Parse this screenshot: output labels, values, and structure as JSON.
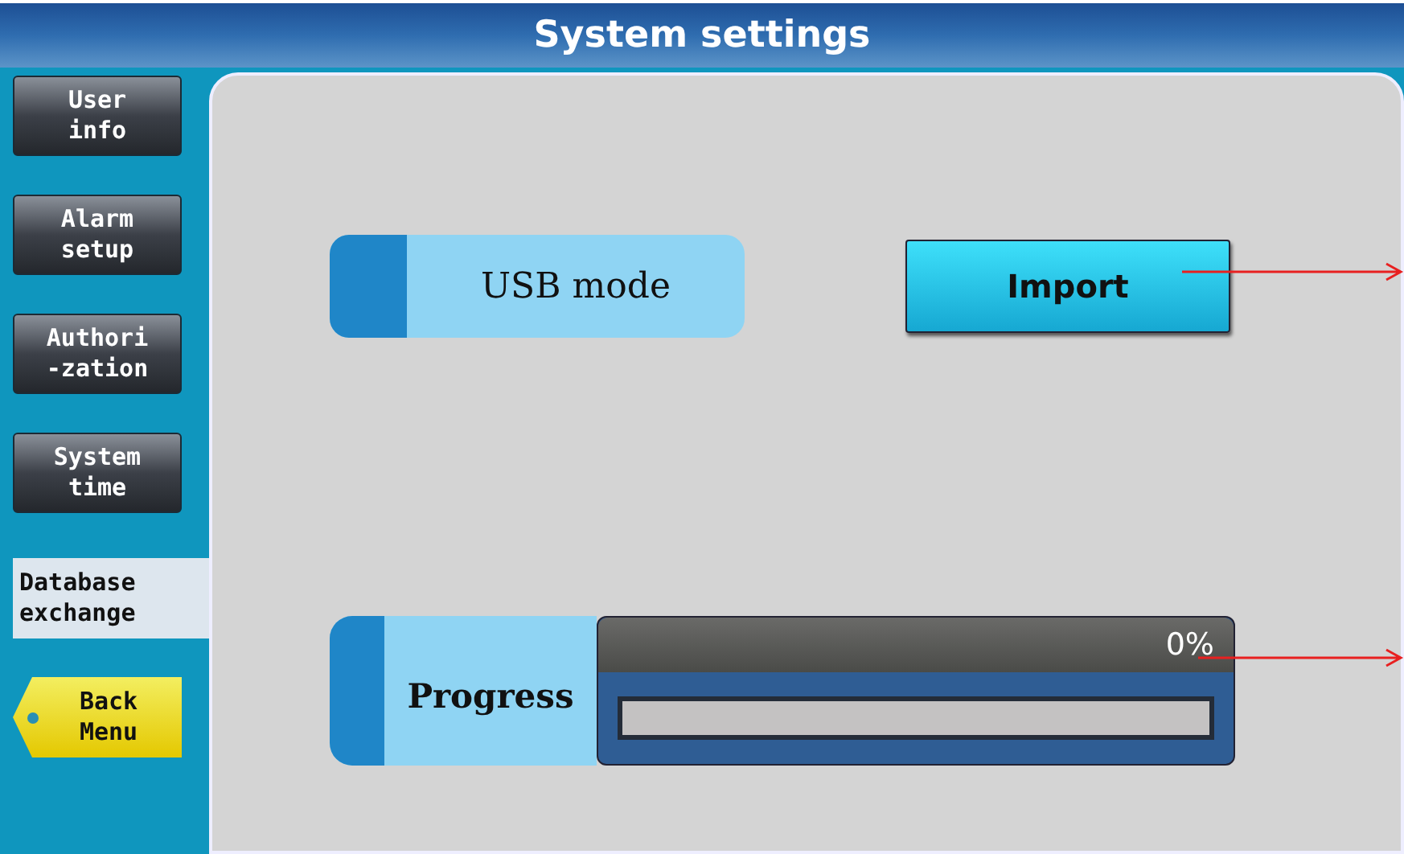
{
  "window": {
    "title": "System settings"
  },
  "sidebar": {
    "items": [
      {
        "label": "User\ninfo",
        "selected": false
      },
      {
        "label": "Alarm\nsetup",
        "selected": false
      },
      {
        "label": "Authori\n-zation",
        "selected": false
      },
      {
        "label": "System\ntime",
        "selected": false
      },
      {
        "label": "Database\nexchange",
        "selected": true
      }
    ],
    "back_button": "Back\nMenu"
  },
  "usb": {
    "label": "USB mode",
    "button": "Import"
  },
  "progress": {
    "label": "Progress",
    "reading": "0%",
    "level": 0
  }
}
